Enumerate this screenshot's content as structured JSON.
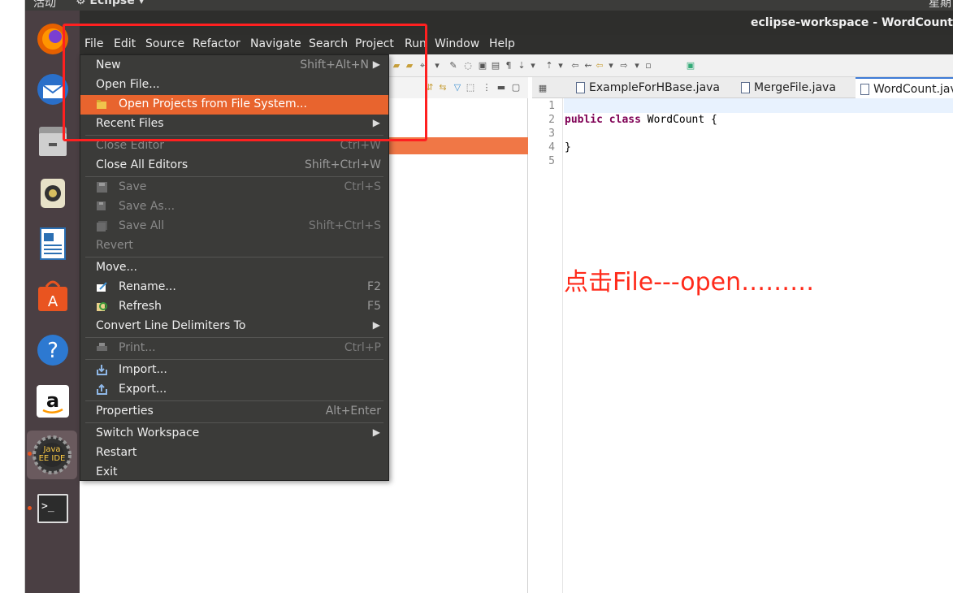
{
  "top_panel": {
    "activities": "活动",
    "app_menu": "⚙ Eclipse ▾",
    "clock": "星期"
  },
  "dock": {
    "items": [
      {
        "name": "firefox-icon",
        "color": "#e66000"
      },
      {
        "name": "thunderbird-icon",
        "color": "#2a6fc9"
      },
      {
        "name": "files-icon",
        "color": "#8c8c8c"
      },
      {
        "name": "rhythmbox-icon",
        "color": "#d8c060"
      },
      {
        "name": "libreoffice-writer-icon",
        "color": "#2a6fb3"
      },
      {
        "name": "software-center-icon",
        "color": "#e95420"
      },
      {
        "name": "help-icon",
        "color": "#2d79d1"
      },
      {
        "name": "amazon-icon",
        "color": "#ffffff"
      },
      {
        "name": "eclipse-javaee-icon",
        "color": "#6a5a5e",
        "label": "Java EE IDE"
      },
      {
        "name": "terminal-icon",
        "color": "#2c2c2c"
      }
    ]
  },
  "window": {
    "title": "eclipse-workspace - WordCount"
  },
  "menubar": [
    "File",
    "Edit",
    "Source",
    "Refactor",
    "Navigate",
    "Search",
    "Project",
    "Run",
    "Window",
    "Help"
  ],
  "file_menu": {
    "new": "New",
    "new_acc": "Shift+Alt+N",
    "open_file": "Open File...",
    "open_projects": "Open Projects from File System...",
    "recent_files": "Recent Files",
    "close_editor": "Close Editor",
    "close_editor_acc": "Ctrl+W",
    "close_all": "Close All Editors",
    "close_all_acc": "Shift+Ctrl+W",
    "save": "Save",
    "save_acc": "Ctrl+S",
    "save_as": "Save As...",
    "save_all": "Save All",
    "save_all_acc": "Shift+Ctrl+S",
    "revert": "Revert",
    "move": "Move...",
    "rename": "Rename...",
    "rename_acc": "F2",
    "refresh": "Refresh",
    "refresh_acc": "F5",
    "convert": "Convert Line Delimiters To",
    "print": "Print...",
    "print_acc": "Ctrl+P",
    "import": "Import...",
    "export": "Export...",
    "properties": "Properties",
    "properties_acc": "Alt+Enter",
    "switch_ws": "Switch Workspace",
    "restart": "Restart",
    "exit": "Exit"
  },
  "editor": {
    "tabs": [
      "ExampleForHBase.java",
      "MergeFile.java",
      "WordCount.java"
    ],
    "line_numbers": [
      "1",
      "2",
      "3",
      "4",
      "5"
    ],
    "code": {
      "kw_public": "public",
      "kw_class": "class",
      "class_rest": " WordCount {",
      "close_brace": "}"
    }
  },
  "annotation": "点击File---open………",
  "colors": {
    "highlight": "#e8642e",
    "annotation": "#ff2a1a",
    "menu_bg": "#3b3b39"
  }
}
